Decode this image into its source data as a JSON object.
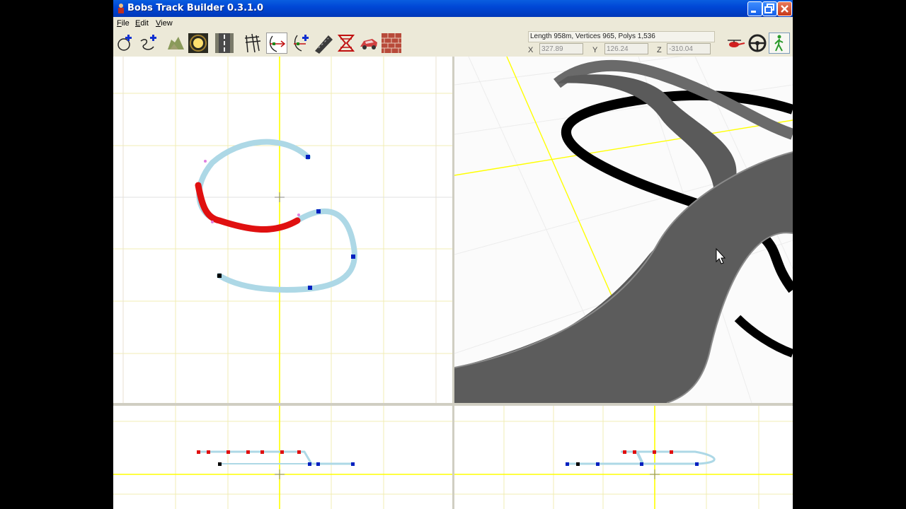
{
  "window": {
    "title": "Bobs Track Builder 0.3.1.0"
  },
  "menu": {
    "items": [
      "File",
      "Edit",
      "View"
    ]
  },
  "toolbar": {
    "icons": [
      "add-loop-icon",
      "add-spline-icon",
      "terrain-icon",
      "sky-icon",
      "road-icon",
      "fence-icon",
      "node-edit-icon",
      "add-node-icon",
      "road-surface-icon",
      "wall-icon",
      "car-icon",
      "brick-icon"
    ]
  },
  "status": {
    "info": "Length 958m, Vertices 965, Polys 1,536",
    "x_label": "X",
    "x_value": "327.89",
    "y_label": "Y",
    "y_value": "126.24",
    "z_label": "Z",
    "z_value": "-310.04"
  },
  "view_modes": [
    "helicopter-view-icon",
    "driver-view-icon",
    "walk-view-icon"
  ],
  "colors": {
    "grid": "#f0ecb4",
    "axis": "#ffff00",
    "track": "#add8e6",
    "selected": "#e01010",
    "node": "#0020c0",
    "road": "#5a5a5a"
  }
}
